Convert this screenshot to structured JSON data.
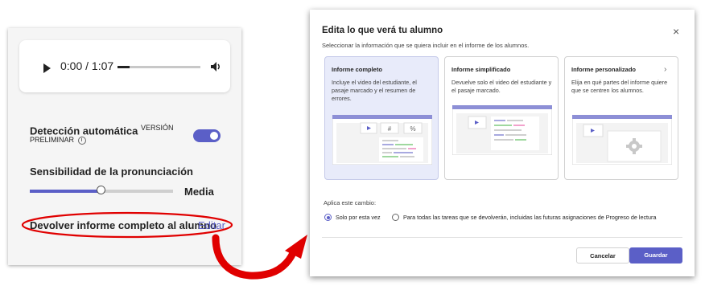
{
  "colors": {
    "accent": "#5b5fc7",
    "highlight_red": "#e00000",
    "selected_card_bg": "#e8ebfa"
  },
  "audio": {
    "time": "0:00 / 1:07",
    "progress": 0.15
  },
  "auto_detect": {
    "label": "Detección automática",
    "badge": "VERSIÓN",
    "badge_cont": "PRELIMINAR",
    "info_icon": "i",
    "enabled": true
  },
  "sensitivity": {
    "label": "Sensibilidad de la pronunciación",
    "value_label": "Media",
    "level": 0.5
  },
  "return_report": {
    "label": "Devolver informe completo al alumno",
    "edit_link": "Editar"
  },
  "dialog": {
    "title": "Edita lo que verá tu alumno",
    "close_icon": "×",
    "subtitle": "Seleccionar la información que se quiera incluir en el informe de los alumnos.",
    "options": [
      {
        "title": "Informe completo",
        "description": "Incluye el video del estudiante, el pasaje marcado y el resumen de errores.",
        "selected": true
      },
      {
        "title": "Informe simplificado",
        "description": "Devuelve solo el video del estudiante y el pasaje marcado.",
        "selected": false
      },
      {
        "title": "Informe personalizado",
        "chevron": "›",
        "description": "Elija en qué partes del informe quiere que se centren los alumnos.",
        "selected": false
      }
    ],
    "apply_label": "Aplica este cambio:",
    "radio_options": [
      {
        "label": "Solo por esta vez",
        "checked": true
      },
      {
        "label": "Para todas las tareas que se devolverán, incluidas las futuras asignaciones de Progreso de lectura",
        "checked": false
      }
    ],
    "cancel_label": "Cancelar",
    "save_label": "Guardar",
    "card_symbols": {
      "hash": "#",
      "percent": "%"
    }
  }
}
